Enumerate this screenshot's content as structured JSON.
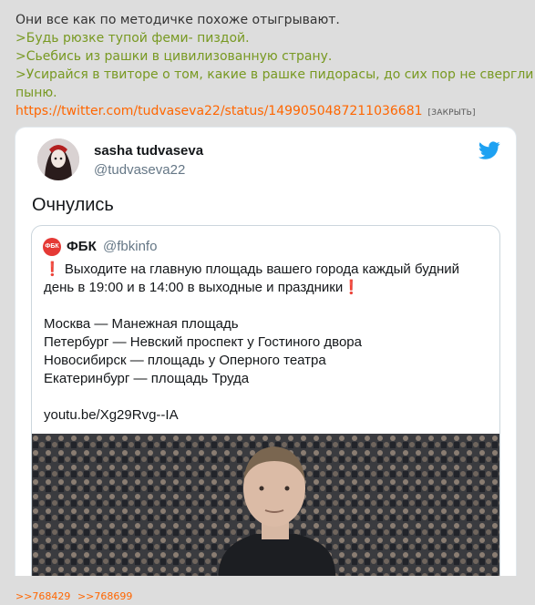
{
  "post": {
    "line1": "Они все как по методичке похоже отыгрывают.",
    "quote1": ">Будь рюзке тупой феми- пиздой.",
    "quote2": ">Сьебись из рашки в цивилизованную страну.",
    "quote3a": ">Усирайся в твиторе о том, какие в рашке пидорасы, до сих пор не свергли",
    "quote3b": "пыню.",
    "link": "https://twitter.com/tudvaseva22/status/1499050487211036681",
    "close_label": "[ЗАКРЫТЬ]"
  },
  "tweet": {
    "author_name": "sasha tudvaseva",
    "author_handle": "@tudvaseva22",
    "text": "Очнулись",
    "quoted": {
      "logo_text": "ФБК",
      "name": "ФБК",
      "handle": "@fbkinfo",
      "excl": "❗",
      "line1": " Выходите на главную площадь вашего города каждый будний день в 19:00 и в 14:00 в выходные и праздники",
      "city1": "Москва — Манежная площадь",
      "city2": "Петербург — Невский проспект у Гостиного двора",
      "city3": "Новосибирск — площадь у Оперного театра",
      "city4": "Екатеринбург — площадь Труда",
      "youtube": "youtu.be/Xg29Rvg--IA"
    }
  },
  "replies": [
    ">>768429",
    ">>768699"
  ],
  "icons": {
    "twitter": "twitter-bird-icon",
    "excl": "exclamation-icon"
  },
  "colors": {
    "background": "#dddddd",
    "quote": "#789922",
    "link": "#ff6600",
    "twitter": "#1da1f2"
  }
}
